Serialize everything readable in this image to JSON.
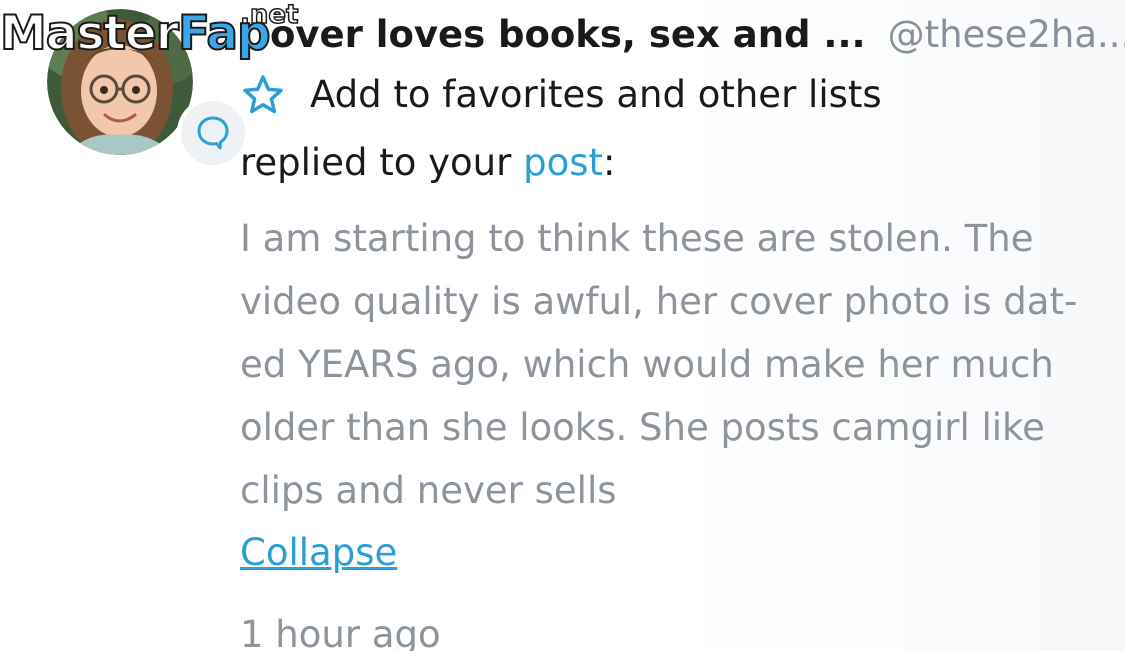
{
  "watermark": {
    "part1": "Master",
    "part2": "Fap",
    "suffix": ".net"
  },
  "notification": {
    "name_fragment": "over loves books, sex and ...",
    "handle": "@these2ha...",
    "favorites_label": "Add to favorites and other lists",
    "replied_prefix": "replied to your",
    "post_link": "post",
    "replied_suffix": ":",
    "comment_lines": [
      "I am starting to think these are stolen. The",
      "video quality is awful, her cover photo is dat-",
      "ed YEARS ago, which would make her much",
      "older than she looks. She posts camgirl like",
      "clips and never sells"
    ],
    "collapse_label": "Collapse",
    "timestamp": "1 hour ago"
  },
  "icons": {
    "avatar": "user-avatar",
    "badge": "reply-bubble-icon",
    "favorite": "star-outline-icon"
  },
  "colors": {
    "link": "#2a9fd6",
    "text": "#1a1a1a",
    "muted": "#8d949c",
    "watermark_accent": "#3aa8e8"
  }
}
